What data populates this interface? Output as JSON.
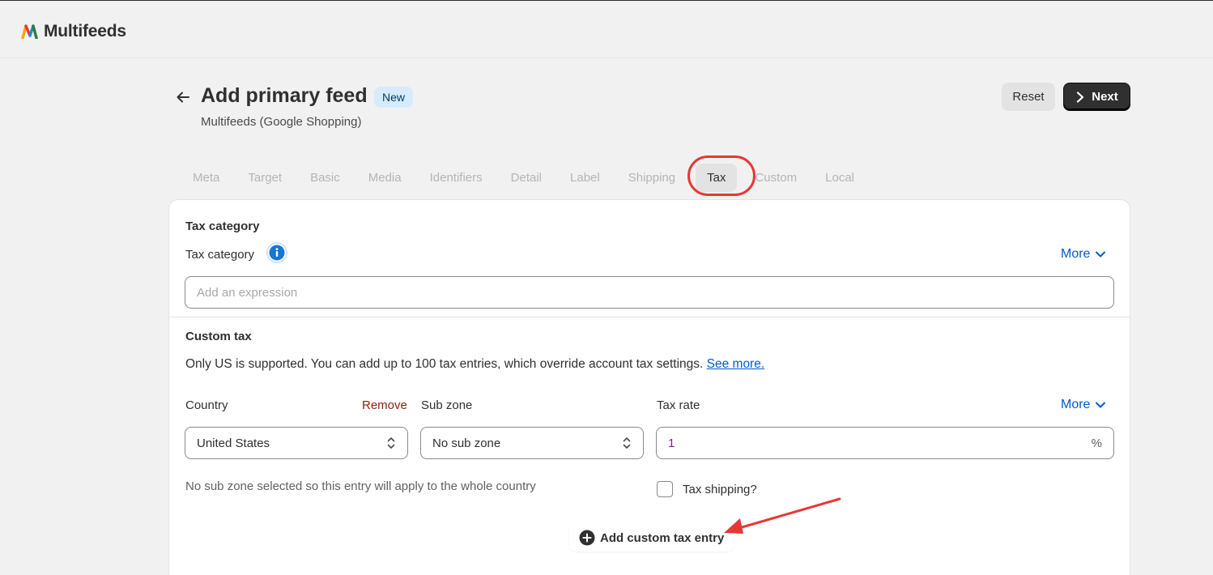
{
  "app": {
    "name": "Multifeeds"
  },
  "header": {
    "title": "Add primary feed",
    "badge": "New",
    "subtitle": "Multifeeds (Google Shopping)",
    "reset_label": "Reset",
    "next_label": "Next"
  },
  "tabs": [
    {
      "label": "Meta"
    },
    {
      "label": "Target"
    },
    {
      "label": "Basic"
    },
    {
      "label": "Media"
    },
    {
      "label": "Identifiers"
    },
    {
      "label": "Detail"
    },
    {
      "label": "Label"
    },
    {
      "label": "Shipping"
    },
    {
      "label": "Tax",
      "active": true
    },
    {
      "label": "Custom"
    },
    {
      "label": "Local"
    }
  ],
  "tax_category": {
    "heading": "Tax category",
    "field_label": "Tax category",
    "more_label": "More",
    "placeholder": "Add an expression"
  },
  "custom_tax": {
    "heading": "Custom tax",
    "description": "Only US is supported. You can add up to 100 tax entries, which override account tax settings.",
    "see_more": "See more.",
    "country_label": "Country",
    "remove_label": "Remove",
    "subzone_label": "Sub zone",
    "taxrate_label": "Tax rate",
    "more_label": "More",
    "country_value": "United States",
    "subzone_value": "No sub zone",
    "taxrate_value": "1",
    "taxrate_suffix": "%",
    "helper": "No sub zone selected so this entry will apply to the whole country",
    "tax_shipping_label": "Tax shipping?",
    "tax_shipping_checked": false,
    "add_entry_label": "Add custom tax entry"
  },
  "colors": {
    "accent": "#005bd3",
    "primary_button": "#303030",
    "annotation": "#e53935",
    "remove": "#8e1f0b"
  }
}
